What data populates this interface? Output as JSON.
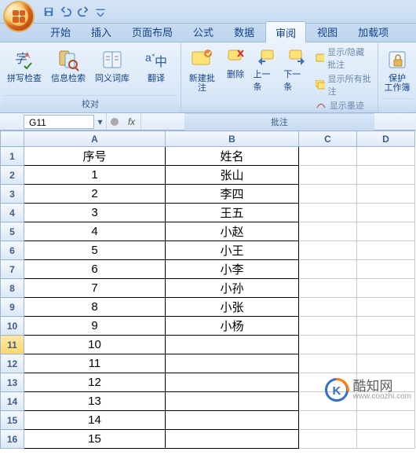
{
  "qat": {
    "save": "save",
    "undo": "undo",
    "redo": "redo"
  },
  "tabs": [
    "开始",
    "插入",
    "页面布局",
    "公式",
    "数据",
    "审阅",
    "视图",
    "加载项"
  ],
  "active_tab_index": 5,
  "ribbon": {
    "group_proof": {
      "label": "校对",
      "spellcheck": "拼写检查",
      "research": "信息检索",
      "thesaurus": "同义词库",
      "translate": "翻译"
    },
    "group_comments": {
      "label": "批注",
      "new_comment": "新建批注",
      "delete": "删除",
      "prev": "上一条",
      "next": "下一条",
      "show_hide": "显示/隐藏批注",
      "show_all": "显示所有批注",
      "show_ink": "显示墨迹"
    },
    "group_changes": {
      "protect": "保护",
      "workbook": "工作簿"
    }
  },
  "name_box": "G11",
  "fx_label": "fx",
  "formula_value": "",
  "columns": [
    "A",
    "B",
    "C",
    "D"
  ],
  "rows": [
    {
      "n": 1,
      "a": "序号",
      "b": "姓名"
    },
    {
      "n": 2,
      "a": "1",
      "b": "张山"
    },
    {
      "n": 3,
      "a": "2",
      "b": "李四"
    },
    {
      "n": 4,
      "a": "3",
      "b": "王五"
    },
    {
      "n": 5,
      "a": "4",
      "b": "小赵"
    },
    {
      "n": 6,
      "a": "5",
      "b": "小王"
    },
    {
      "n": 7,
      "a": "6",
      "b": "小李"
    },
    {
      "n": 8,
      "a": "7",
      "b": "小孙"
    },
    {
      "n": 9,
      "a": "8",
      "b": "小张"
    },
    {
      "n": 10,
      "a": "9",
      "b": "小杨"
    },
    {
      "n": 11,
      "a": "10",
      "b": ""
    },
    {
      "n": 12,
      "a": "11",
      "b": ""
    },
    {
      "n": 13,
      "a": "12",
      "b": ""
    },
    {
      "n": 14,
      "a": "13",
      "b": ""
    },
    {
      "n": 15,
      "a": "14",
      "b": ""
    },
    {
      "n": 16,
      "a": "15",
      "b": ""
    }
  ],
  "selected_row": 11,
  "watermark": {
    "text": "酷知网",
    "sub": "www.coozhi.com"
  }
}
